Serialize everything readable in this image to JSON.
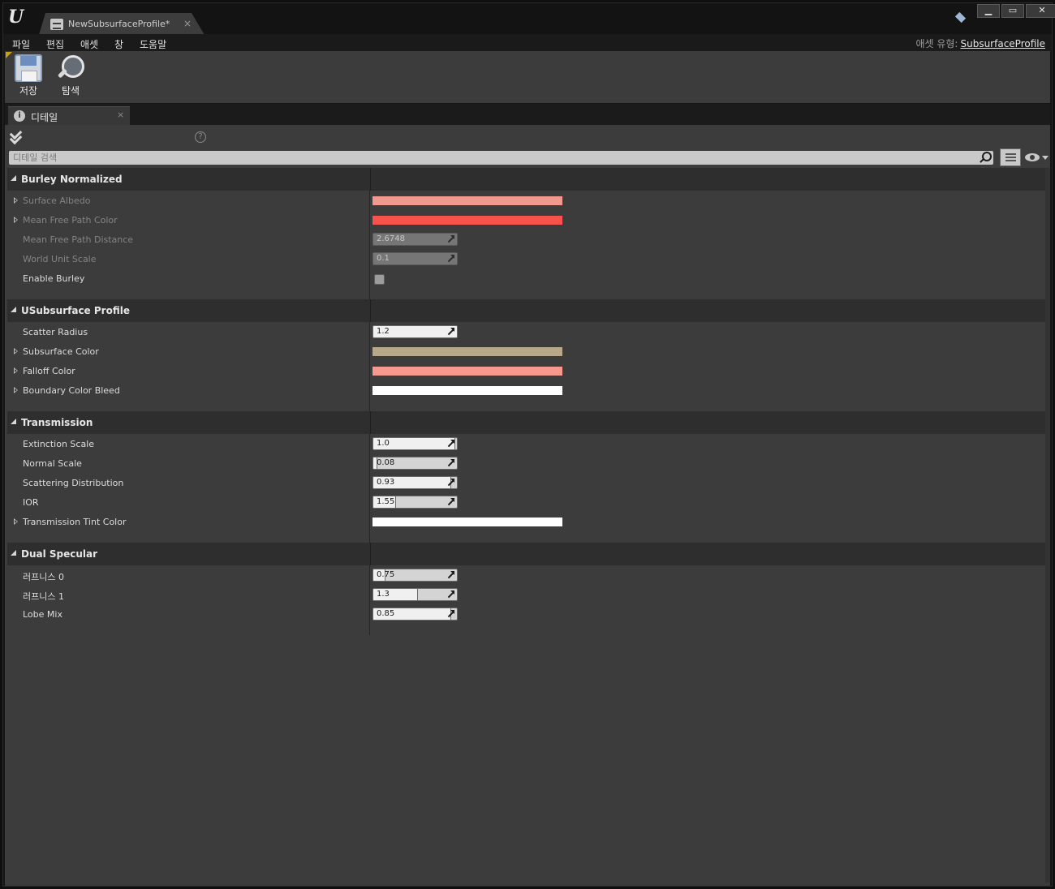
{
  "window": {
    "tab_title": "NewSubsurfaceProfile*",
    "tab_close": "×",
    "logo": "U",
    "min_btn": "▁",
    "max_btn": "▭",
    "close_btn": "✕"
  },
  "menu": {
    "items": [
      "파일",
      "편집",
      "애셋",
      "창",
      "도움말"
    ],
    "asset_type_label": "애셋 유형:",
    "asset_type_value": "SubsurfaceProfile"
  },
  "toolbar": {
    "save_label": "저장",
    "find_label": "탐색"
  },
  "details": {
    "tab_label": "디테일",
    "tab_close": "×",
    "info_icon": "i",
    "help_icon": "?",
    "search_placeholder": "디테일 검색"
  },
  "colors": {
    "surface_albedo": "#f2998f",
    "mean_free_path_color": "#f8524c",
    "subsurface_color": "#b8a88a",
    "falloff_color": "#f6998f",
    "boundary_color_bleed": "#ffffff",
    "transmission_tint_color": "#ffffff"
  },
  "categories": [
    {
      "title": "Burley Normalized",
      "properties": [
        {
          "name": "Surface Albedo",
          "type": "color",
          "expandable": true,
          "dim": true,
          "color_key": "surface_albedo"
        },
        {
          "name": "Mean Free Path Color",
          "type": "color",
          "expandable": true,
          "dim": true,
          "color_key": "mean_free_path_color"
        },
        {
          "name": "Mean Free Path Distance",
          "type": "number",
          "value": "2.6748",
          "dim": true,
          "disabled": true
        },
        {
          "name": "World Unit Scale",
          "type": "number",
          "value": "0.1",
          "dim": true,
          "disabled": true
        },
        {
          "name": "Enable Burley",
          "type": "checkbox",
          "checked": false
        }
      ]
    },
    {
      "title": "USubsurface Profile",
      "properties": [
        {
          "name": "Scatter Radius",
          "type": "number",
          "value": "1.2"
        },
        {
          "name": "Subsurface Color",
          "type": "color",
          "expandable": true,
          "color_key": "subsurface_color"
        },
        {
          "name": "Falloff Color",
          "type": "color",
          "expandable": true,
          "color_key": "falloff_color"
        },
        {
          "name": "Boundary Color Bleed",
          "type": "color",
          "expandable": true,
          "color_key": "boundary_color_bleed"
        }
      ]
    },
    {
      "title": "Transmission",
      "properties": [
        {
          "name": "Extinction Scale",
          "type": "number",
          "value": "1.0",
          "fraction": 0.98
        },
        {
          "name": "Normal Scale",
          "type": "number",
          "value": "0.08",
          "fraction": 0.05
        },
        {
          "name": "Scattering Distribution",
          "type": "number",
          "value": "0.93",
          "fraction": 0.93
        },
        {
          "name": "IOR",
          "type": "number",
          "value": "1.55",
          "fraction": 0.27
        },
        {
          "name": "Transmission Tint Color",
          "type": "color",
          "expandable": true,
          "color_key": "transmission_tint_color"
        }
      ]
    },
    {
      "title": "Dual Specular",
      "properties": [
        {
          "name": "러프니스 0",
          "type": "number",
          "value": "0.75",
          "fraction": 0.15
        },
        {
          "name": "러프니스 1",
          "type": "number",
          "value": "1.3",
          "fraction": 0.53
        },
        {
          "name": "Lobe Mix",
          "type": "number",
          "value": "0.85",
          "fraction": 0.93
        }
      ]
    }
  ]
}
